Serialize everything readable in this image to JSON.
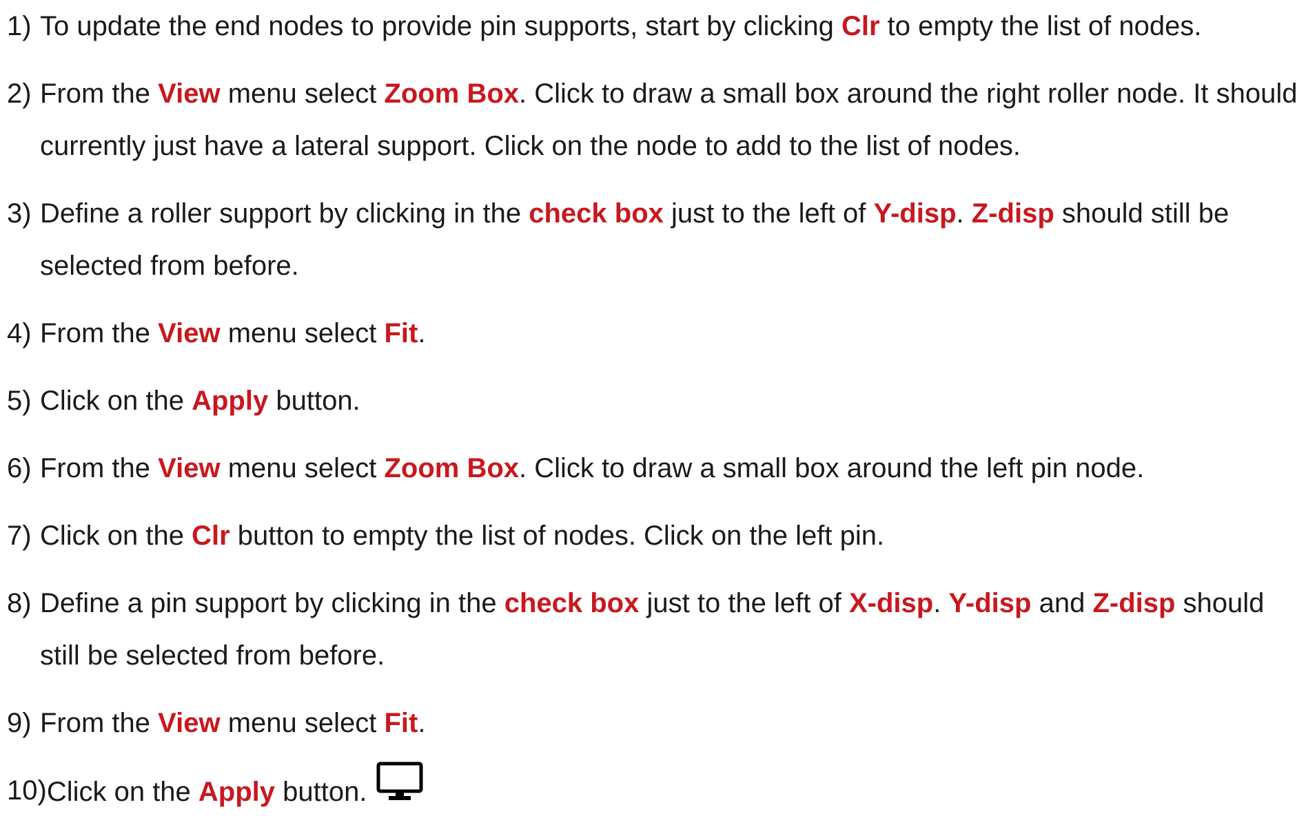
{
  "colors": {
    "highlight": "#c8181e",
    "text": "#1a1a1a"
  },
  "steps": [
    {
      "num": "1)",
      "parts": [
        {
          "t": "To update the end nodes to provide pin supports, start by clicking "
        },
        {
          "t": "Clr",
          "hl": true
        },
        {
          "t": " to empty the list of nodes."
        }
      ]
    },
    {
      "num": "2)",
      "parts": [
        {
          "t": "From the "
        },
        {
          "t": "View",
          "hl": true
        },
        {
          "t": " menu select "
        },
        {
          "t": "Zoom Box",
          "hl": true
        },
        {
          "t": ". Click to draw a small box around the right roller node. It should currently just have a lateral support. Click on the node to add to the list of nodes."
        }
      ]
    },
    {
      "num": "3)",
      "parts": [
        {
          "t": "Define a roller support by clicking in the "
        },
        {
          "t": "check box",
          "hl": true
        },
        {
          "t": " just to the left of "
        },
        {
          "t": "Y-disp",
          "hl": true
        },
        {
          "t": ". "
        },
        {
          "t": "Z-disp",
          "hl": true
        },
        {
          "t": " should still be selected from before."
        }
      ]
    },
    {
      "num": "4)",
      "parts": [
        {
          "t": "From the "
        },
        {
          "t": "View",
          "hl": true
        },
        {
          "t": " menu select "
        },
        {
          "t": "Fit",
          "hl": true
        },
        {
          "t": "."
        }
      ]
    },
    {
      "num": "5)",
      "parts": [
        {
          "t": "Click on the "
        },
        {
          "t": "Apply",
          "hl": true
        },
        {
          "t": " button."
        }
      ]
    },
    {
      "num": "6)",
      "parts": [
        {
          "t": "From the "
        },
        {
          "t": "View",
          "hl": true
        },
        {
          "t": " menu select "
        },
        {
          "t": "Zoom Box",
          "hl": true
        },
        {
          "t": ". Click to draw a small box around the left pin node."
        }
      ]
    },
    {
      "num": "7)",
      "parts": [
        {
          "t": "Click on the "
        },
        {
          "t": "Clr",
          "hl": true
        },
        {
          "t": " button to empty the list of nodes. Click on the left pin."
        }
      ]
    },
    {
      "num": "8)",
      "parts": [
        {
          "t": "Define a pin support by clicking in the "
        },
        {
          "t": "check box",
          "hl": true
        },
        {
          "t": " just to the left of "
        },
        {
          "t": "X-disp",
          "hl": true
        },
        {
          "t": ". "
        },
        {
          "t": "Y-disp",
          "hl": true
        },
        {
          "t": " and "
        },
        {
          "t": "Z-disp",
          "hl": true
        },
        {
          "t": " should still be selected from before."
        }
      ]
    },
    {
      "num": "9)",
      "parts": [
        {
          "t": "From the "
        },
        {
          "t": "View",
          "hl": true
        },
        {
          "t": " menu select "
        },
        {
          "t": "Fit",
          "hl": true
        },
        {
          "t": "."
        }
      ]
    },
    {
      "num": "10)",
      "last": true,
      "parts": [
        {
          "t": "Click on the "
        },
        {
          "t": "Apply",
          "hl": true
        },
        {
          "t": " button."
        }
      ],
      "icon": "monitor-icon"
    }
  ]
}
